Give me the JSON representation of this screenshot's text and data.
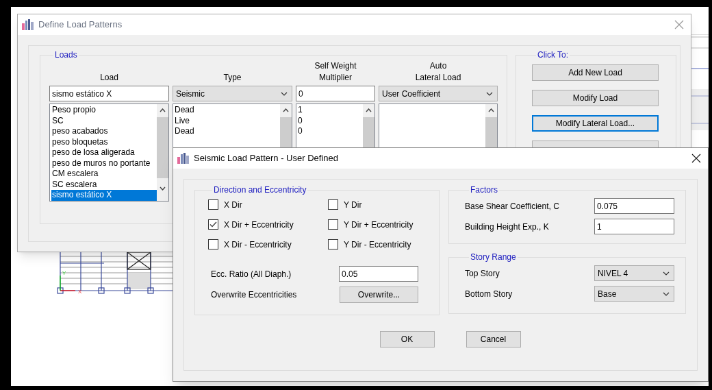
{
  "plan": {
    "axis_labels": [
      "X",
      "Y"
    ]
  },
  "define_dialog": {
    "title": "Define Load Patterns",
    "active": false,
    "loads_group": {
      "legend": "Loads",
      "headers": [
        "Load",
        "Type",
        "Self Weight\nMultiplier",
        "Auto\nLateral Load"
      ],
      "load_name": "sismo estático X",
      "type": "Seismic",
      "self_weight": "0",
      "auto_lateral": "User Coefficient",
      "loads": [
        {
          "label": "Peso propio",
          "selected": false
        },
        {
          "label": "SC",
          "selected": false
        },
        {
          "label": "peso acabados",
          "selected": false
        },
        {
          "label": "peso bloquetas",
          "selected": false
        },
        {
          "label": "peso de losa aligerada",
          "selected": false
        },
        {
          "label": "peso de muros no portante",
          "selected": false
        },
        {
          "label": "CM escalera",
          "selected": false
        },
        {
          "label": "SC escalera",
          "selected": false
        },
        {
          "label": "sismo estático X",
          "selected": true
        }
      ],
      "types": [
        "Dead",
        "Live",
        "Dead"
      ],
      "multipliers": [
        "1",
        "0",
        "0"
      ]
    },
    "click_group": {
      "legend": "Click To:",
      "buttons": [
        {
          "label": "Add New Load",
          "focused": false
        },
        {
          "label": "Modify Load",
          "focused": false
        },
        {
          "label": "Modify Lateral Load...",
          "focused": true
        }
      ]
    }
  },
  "seismic_dialog": {
    "title": "Seismic Load Pattern - User Defined",
    "active": true,
    "direction_group": {
      "legend": "Direction and Eccentricity",
      "options": [
        {
          "label": "X Dir",
          "checked": false
        },
        {
          "label": "Y Dir",
          "checked": false
        },
        {
          "label": "X Dir + Eccentricity",
          "checked": true
        },
        {
          "label": "Y Dir + Eccentricity",
          "checked": false
        },
        {
          "label": "X Dir - Eccentricity",
          "checked": false
        },
        {
          "label": "Y Dir - Eccentricity",
          "checked": false
        }
      ],
      "ecc_ratio_label": "Ecc. Ratio (All Diaph.)",
      "ecc_ratio": "0.05",
      "overwrite_label": "Overwrite Eccentricities",
      "overwrite_button": "Overwrite..."
    },
    "factors_group": {
      "legend": "Factors",
      "fields": [
        {
          "label": "Base Shear Coefficient, C",
          "value": "0.075"
        },
        {
          "label": "Building Height Exp., K",
          "value": "1"
        }
      ]
    },
    "story_group": {
      "legend": "Story Range",
      "fields": [
        {
          "label": "Top Story",
          "value": "NIVEL 4"
        },
        {
          "label": "Bottom Story",
          "value": "Base"
        }
      ]
    },
    "buttons": [
      "OK",
      "Cancel"
    ]
  }
}
